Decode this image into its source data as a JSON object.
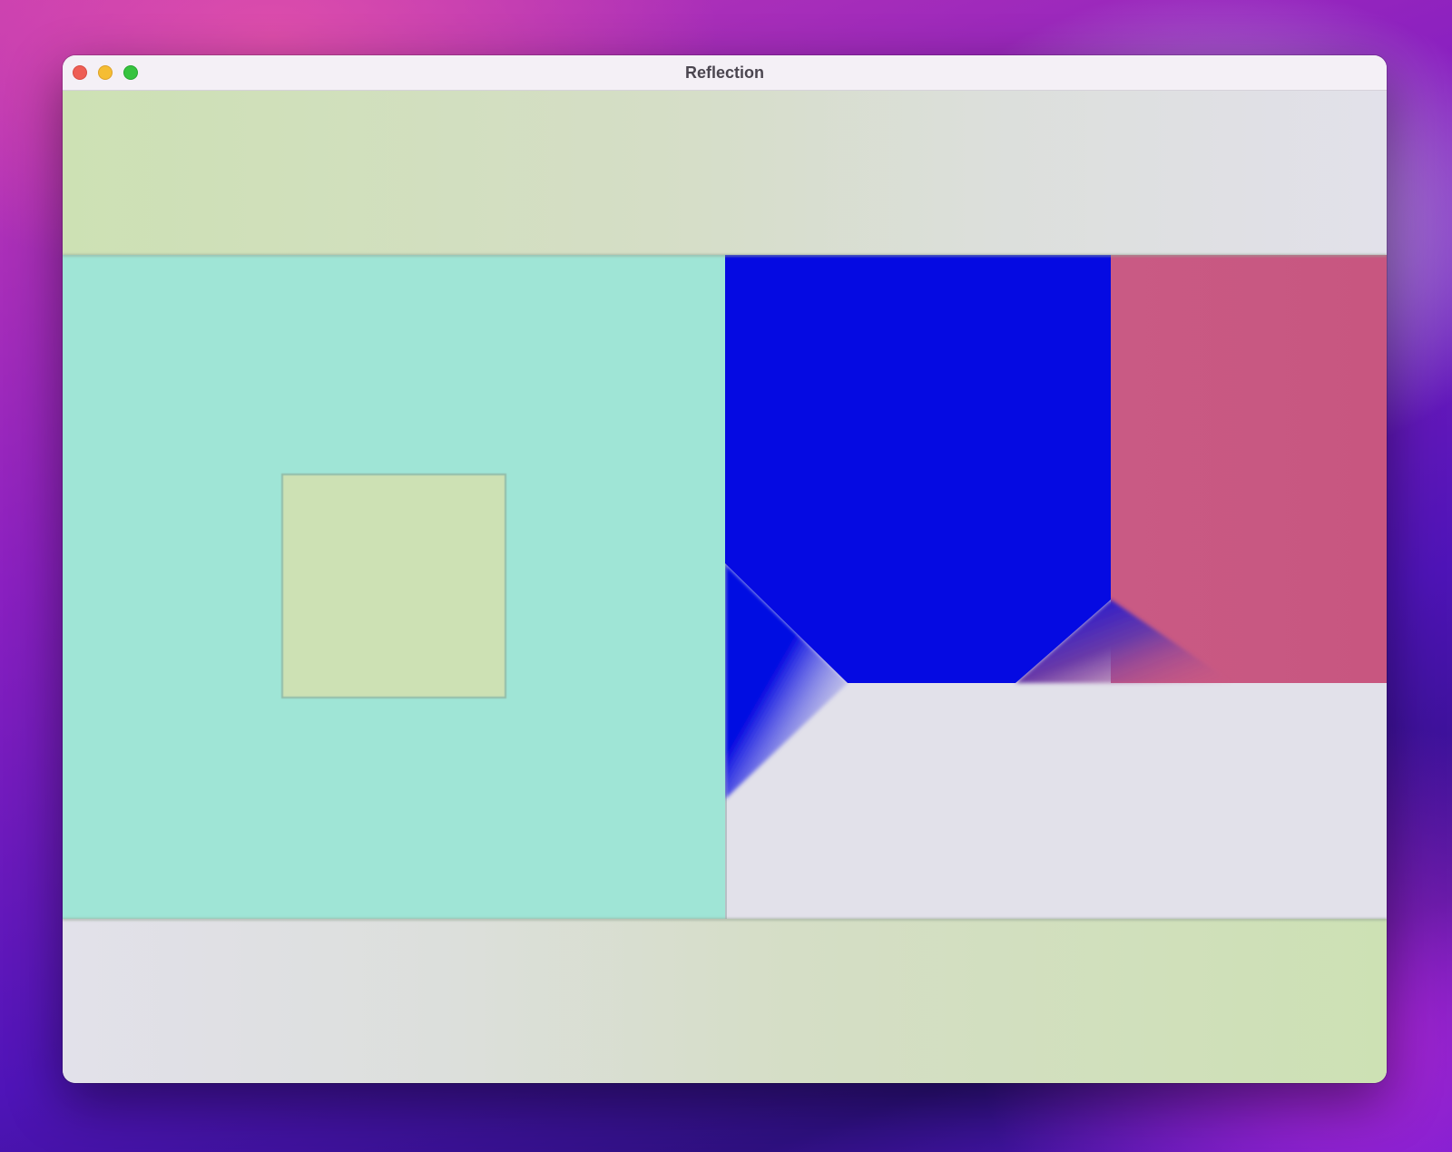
{
  "window": {
    "title": "Reflection",
    "controls": [
      "close",
      "minimize",
      "zoom"
    ]
  },
  "colors": {
    "teal": "#9fe5d6",
    "lime": "#cde1b4",
    "lavender": "#e2e1ea",
    "blue": "#050ae2",
    "rose": "#c85882"
  }
}
